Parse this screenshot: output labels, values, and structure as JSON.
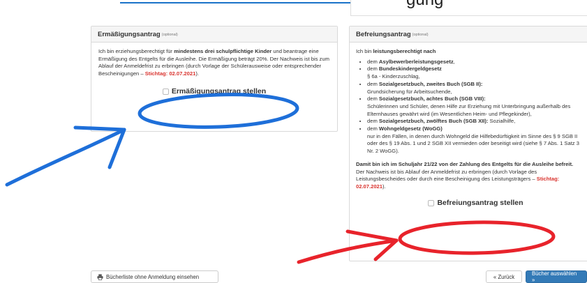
{
  "top": {
    "link_text": "",
    "right_text": "gung"
  },
  "left_panel": {
    "title": "Ermäßigungsantrag",
    "optional": "(optional)",
    "text_1": "Ich bin erziehungsberechtigt für ",
    "text_bold": "mindestens drei schulpflichtige Kinder",
    "text_2": " und beantrage eine Ermäßigung des Entgelts für die Ausleihe. Die Ermäßigung beträgt 20%. Der Nachweis ist bis zum Ablauf der Anmeldefrist zu erbringen (durch Vorlage der Schülerausweise oder entsprechender Bescheinigungen – ",
    "deadline": "Stichtag: 02.07.2021",
    "text_3": ").",
    "checkbox_label": "Ermäßigungsantrag stellen"
  },
  "right_panel": {
    "title": "Befreiungsantrag",
    "optional": "(optional)",
    "intro_1": "Ich bin ",
    "intro_bold": "leistungsberechtigt nach",
    "items": [
      {
        "pre": "dem ",
        "bold": "Asylbewerberleistungsgesetz",
        "post": ","
      },
      {
        "pre": "dem ",
        "bold": "Bundeskindergeldgesetz",
        "post": "",
        "sub": "§ 6a - Kinderzuschlag,"
      },
      {
        "pre": "dem ",
        "bold": "Sozialgesetzbuch, zweites Buch (SGB II):",
        "post": "",
        "sub": "Grundsicherung für Arbeitsuchende,"
      },
      {
        "pre": "dem ",
        "bold": "Sozialgesetzbuch, achtes Buch (SGB VIII):",
        "post": "",
        "sub": "Schülerinnen und Schüler, denen Hilfe zur Erziehung mit Unterbringung außerhalb des Elternhauses gewährt wird (im Wesentlichen Heim- und Pflegekinder),"
      },
      {
        "pre": "dem ",
        "bold": "Sozialgesetzbuch, zwölftes Buch (SGB XII):",
        "post": " Sozialhilfe,"
      },
      {
        "pre": "dem ",
        "bold": "Wohngeldgesetz (WoGG)",
        "post": "",
        "sub": "nur in den Fällen, in denen durch Wohngeld die Hilfebedürftigkeit im Sinne des § 9 SGB II oder des § 19 Abs. 1 und 2 SGB XII vermieden oder beseitigt wird (siehe § 7 Abs. 1 Satz 3 Nr. 2 WoGG)."
      }
    ],
    "summary_bold": "Damit bin ich im Schuljahr 21/22 von der Zahlung des Entgelts für die Ausleihe befreit.",
    "summary_text": " Der Nachweis ist bis Ablauf der Anmeldefrist zu erbringen (durch Vorlage des Leistungsbescheides oder durch eine Bescheinigung des Leistungsträgers – ",
    "deadline": "Stichtag: 02.07.2021",
    "summary_end": ").",
    "checkbox_label": "Befreiungsantrag stellen"
  },
  "footer": {
    "print_label": "Bücherliste ohne Anmeldung einsehen",
    "back_label": "« Zurück",
    "next_label": "Bücher auswählen »"
  },
  "colors": {
    "annotation_blue": "#1e6fd9",
    "annotation_red": "#e8232b",
    "primary": "#337ab7"
  },
  "icons": {
    "print": "printer-icon"
  }
}
